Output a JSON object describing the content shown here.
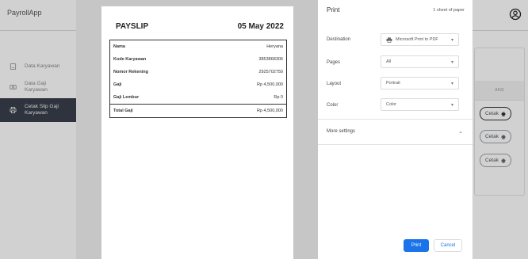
{
  "app": {
    "title": "PayrollApp",
    "sidebar": [
      {
        "label": "Data Karyawan",
        "icon": "id-card-icon"
      },
      {
        "label": "Data Gaji\nKaryawan",
        "icon": "money-icon"
      },
      {
        "label": "Cetak Slip Gaji\nKaryawan",
        "icon": "printer-icon"
      }
    ],
    "aksi_header": "AKSI",
    "cetak_label": "Cetak"
  },
  "payslip": {
    "title": "PAYSLIP",
    "date": "05 May 2022",
    "rows": [
      {
        "key": "Nama",
        "value": "Heryana"
      },
      {
        "key": "Kode Karyawan",
        "value": "3853868306"
      },
      {
        "key": "Nomor Rekening",
        "value": "2925702750"
      },
      {
        "key": "Gaji",
        "value": "Rp 4,500,000"
      },
      {
        "key": "Gaji Lembur",
        "value": "Rp 0"
      }
    ],
    "total": {
      "key": "Total Gaji",
      "value": "Rp 4,500,000"
    }
  },
  "print_dialog": {
    "title": "Print",
    "sheets": "1 sheet of paper",
    "destination_label": "Destination",
    "destination_value": "Microsoft Print to PDF",
    "pages_label": "Pages",
    "pages_value": "All",
    "layout_label": "Layout",
    "layout_value": "Portrait",
    "color_label": "Color",
    "color_value": "Color",
    "more_settings": "More settings",
    "print_button": "Print",
    "cancel_button": "Cancel"
  },
  "colors": {
    "primary": "#1a73e8",
    "sidebar_active": "#3a3f4b"
  }
}
